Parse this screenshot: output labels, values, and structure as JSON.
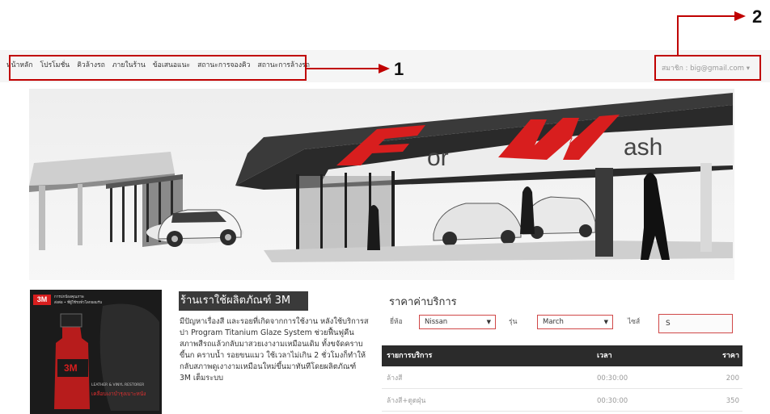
{
  "nav": {
    "items": [
      "หน้าหลัก",
      "โปรโมชั่น",
      "คิวล้างรถ",
      "ภายในร้าน",
      "ข้อเสนอแนะ",
      "สถานะการจองคิว",
      "สถานะการล้างรถ"
    ],
    "user_label": "สมาชิก : big@gmail.com ▾"
  },
  "annotations": {
    "label_1": "1",
    "label_2": "2"
  },
  "hero": {
    "logo_text_1": "or",
    "logo_text_2": "ash"
  },
  "banner": {
    "brand": "3M",
    "tagline_1": "การปกป้องคุณภาพ",
    "tagline_2": "ส่งต่อ • ที่ผู้ใช้รถทั่วโลกยอมรับ",
    "product_label": "LEATHER & VINYL RESTORER",
    "product_caption": "เคลือบเงาบำรุงเบาะหนัง"
  },
  "section": {
    "title": "ร้านเราใช้ผลิตภัณฑ์ 3M",
    "description": "มีปัญหาเรื่องสี และรอยที่เกิดจากการใช้งาน หลังใช้บริการสปา Program Titanium Glaze System ช่วยฟื้นฟูคืนสภาพสีรถแล้วกลับมาสวยเงางามเหมือนเดิม ทั้งขจัดคราบขี้นก คราบน้ำ รอยขนแมว ใช้เวลาไม่เกิน 2 ชั่วโมงก็ทำให้กลับสภาพดูเงางามเหมือนใหม่ขึ้นมาทันทีโดยผลิตภัณฑ์ 3M เต็มระบบ"
  },
  "pricing": {
    "title": "ราคาค่าบริการ",
    "brand_label": "ยี่ห้อ",
    "brand_value": "Nissan",
    "model_label": "รุ่น",
    "model_value": "March",
    "size_label": "ไซส์",
    "size_value": "S",
    "columns": [
      "รายการบริการ",
      "เวลา",
      "ราคา"
    ],
    "rows": [
      {
        "service": "ล้างสี",
        "time": "00:30:00",
        "price": "200"
      },
      {
        "service": "ล้างสี+ดูดฝุ่น",
        "time": "00:30:00",
        "price": "350"
      }
    ]
  },
  "colors": {
    "annotation_red": "#c00000",
    "brand_red": "#d81e1e",
    "table_header": "#2b2b2b"
  }
}
